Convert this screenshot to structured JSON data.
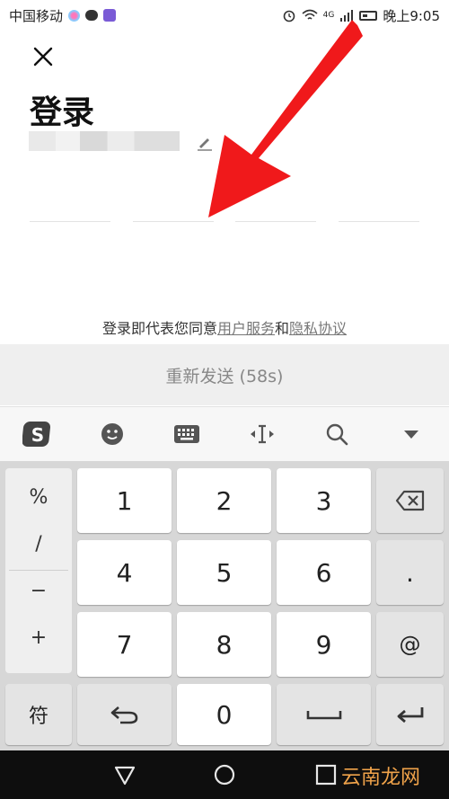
{
  "status_bar": {
    "carrier": "中国移动",
    "network": "4G",
    "time": "晚上9:05"
  },
  "login": {
    "title": "登录",
    "agreement_prefix": "登录即代表您同意",
    "terms_link": "用户服务",
    "agreement_and": "和",
    "privacy_link": "隐私协议",
    "resend_label": "重新发送 (58s)"
  },
  "keyboard": {
    "toolbar_icons": [
      "sogou-logo-icon",
      "emoji-icon",
      "keyboard-icon",
      "cursor-icon",
      "search-icon",
      "collapse-icon"
    ],
    "symbols": [
      "%",
      "/",
      "−",
      "+"
    ],
    "digits": [
      "1",
      "2",
      "3",
      "4",
      "5",
      "6",
      "7",
      "8",
      "9",
      "0"
    ],
    "dot_key": ".",
    "at_key": "@",
    "symbol_key": "符"
  },
  "watermark": "云南龙网",
  "colors": {
    "arrow": "#f0191b",
    "watermark": "#f0a34a"
  }
}
